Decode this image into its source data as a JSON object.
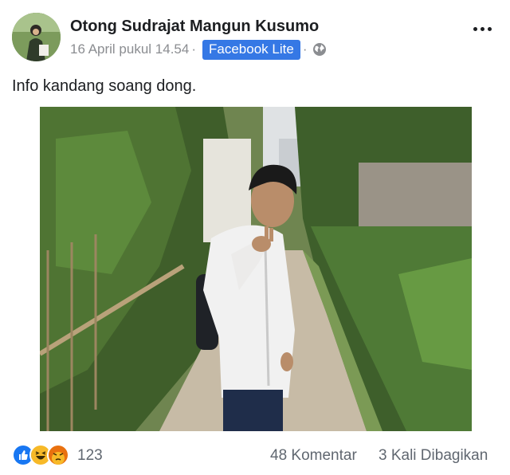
{
  "post": {
    "author": "Otong Sudrajat Mangun Kusumo",
    "timestamp": "16 April pukul 14.54",
    "separator": "·",
    "app_badge": "Facebook Lite",
    "privacy_icon": "globe-icon",
    "more_icon": "more-options-icon",
    "text": "Info kandang soang dong.",
    "photo_icon": "post-photo"
  },
  "footer": {
    "reaction_icons": [
      "like-icon",
      "haha-icon",
      "angry-icon"
    ],
    "reaction_count": "123",
    "comments": "48 Komentar",
    "shares": "3 Kali Dibagikan"
  },
  "colors": {
    "badge": "#3578e5",
    "meta_text": "#8b8d91",
    "footer_text": "#606770",
    "like": "#1877f2",
    "haha": "#f7b928",
    "angry": "#e9710f"
  }
}
